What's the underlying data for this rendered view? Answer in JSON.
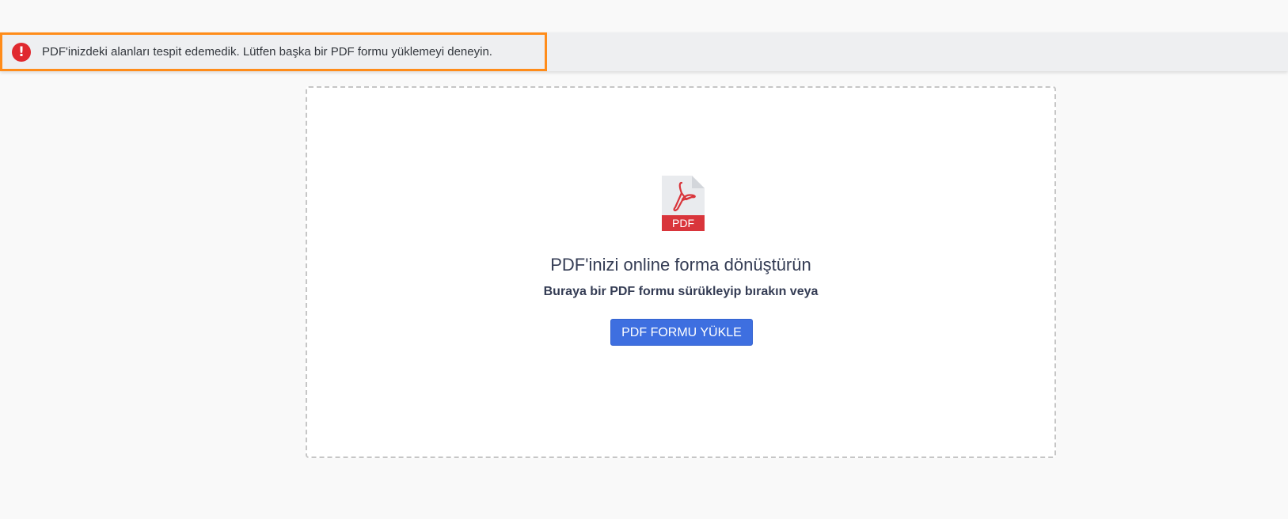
{
  "error": {
    "icon": "exclamation-circle-icon",
    "icon_glyph": "!",
    "message": "PDF'inizdeki alanları tespit edemedik. Lütfen başka bir PDF formu yüklemeyi deneyin.",
    "icon_color": "#e0292f",
    "highlight_color": "#ff8c1a"
  },
  "upload": {
    "icon": "pdf-file-icon",
    "icon_label": "PDF",
    "title": "PDF'inizi online forma dönüştürün",
    "subtitle": "Buraya bir PDF formu sürükleyip bırakın veya",
    "button_label": "PDF FORMU YÜKLE",
    "button_color": "#3e6fe0"
  }
}
